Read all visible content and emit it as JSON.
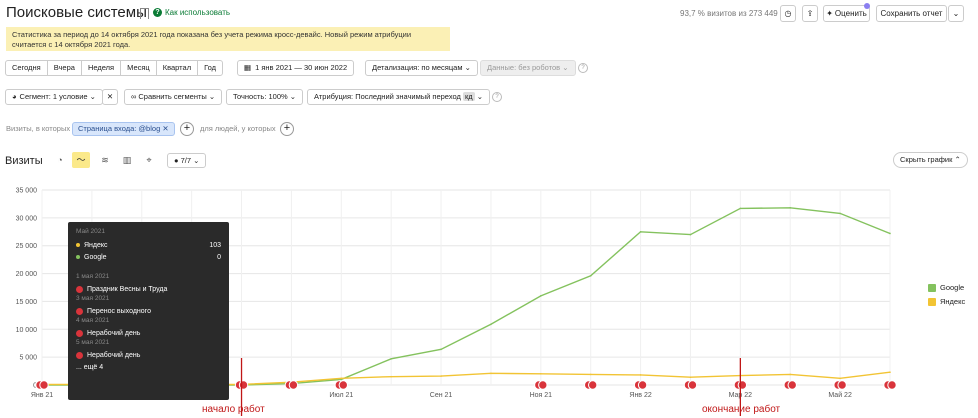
{
  "header": {
    "title": "Поисковые системы",
    "howto": "Как использовать",
    "visits_share": "93,7 % визитов из 273 449",
    "rate_label": "Оценить",
    "save_label": "Сохранить отчет"
  },
  "notice": "Статистика за период до 14 октября 2021 года показана без учета режима кросс-девайс. Новый режим атрибуции считается с 14 октября 2021 года.",
  "periods": [
    "Сегодня",
    "Вчера",
    "Неделя",
    "Месяц",
    "Квартал",
    "Год"
  ],
  "date_range": "1 янв 2021 — 30 июн 2022",
  "detail": "Детализация: по месяцам",
  "data_filter": "Данные: без роботов",
  "segment": "Сегмент: 1 условие",
  "compare": "Сравнить сегменты",
  "accuracy": "Точность: 100%",
  "attribution": "Атрибуция: Последний значимый переход",
  "attribution_badge": "кд",
  "filter": {
    "prefix": "Визиты, в которых",
    "chip": "Страница входа: @blog",
    "suffix": "для людей, у которых"
  },
  "visits_section": {
    "title": "Визиты",
    "notes_label": "7/7",
    "hide_chart": "Скрыть график"
  },
  "tooltip": {
    "date": "Май 2021",
    "rows": [
      {
        "name": "Яндекс",
        "value": "103"
      },
      {
        "name": "Google",
        "value": "0"
      }
    ],
    "events": [
      {
        "date": "1 мая 2021",
        "title": "Праздник Весны и Труда"
      },
      {
        "date": "3 мая 2021",
        "title": "Перенос выходного"
      },
      {
        "date": "4 мая 2021",
        "title": "Нерабочий день"
      },
      {
        "date": "5 мая 2021",
        "title": "Нерабочий день"
      }
    ],
    "more": "... ещё 4"
  },
  "annotations": {
    "start": "начало работ",
    "end": "окончание работ"
  },
  "colors": {
    "google": "#84c25e",
    "yandex": "#f2c434",
    "event": "#d9343b",
    "marker_line": "#c01717"
  },
  "chart_data": {
    "type": "line",
    "x": [
      "Янв 21",
      "Фев 21",
      "Мар 21",
      "Апр 21",
      "Май 21",
      "Июн 21",
      "Июл 21",
      "Авг 21",
      "Сен 21",
      "Окт 21",
      "Ноя 21",
      "Дек 21",
      "Янв 22",
      "Фев 22",
      "Мар 22",
      "Апр 22",
      "Май 22",
      "Июн 22"
    ],
    "x_tick_labels": [
      "Янв 21",
      "Июл 21",
      "Сен 21",
      "Ноя 21",
      "Янв 22",
      "Мар 22",
      "Май 22"
    ],
    "y_ticks": [
      "0",
      "5 000",
      "10 000",
      "15 000",
      "20 000",
      "25 000",
      "30 000",
      "35 000"
    ],
    "ylim": [
      0,
      35000
    ],
    "series": [
      {
        "name": "Google",
        "values": [
          0,
          0,
          0,
          0,
          0,
          250,
          1000,
          4700,
          6400,
          10900,
          16000,
          19600,
          27500,
          27000,
          31700,
          31800,
          30800,
          27200
        ]
      },
      {
        "name": "Яндекс",
        "values": [
          100,
          100,
          100,
          100,
          103,
          500,
          1200,
          1500,
          1600,
          2100,
          2000,
          1900,
          1800,
          1400,
          1700,
          1900,
          1200,
          2300
        ]
      }
    ],
    "grid": true,
    "legend": "right"
  }
}
